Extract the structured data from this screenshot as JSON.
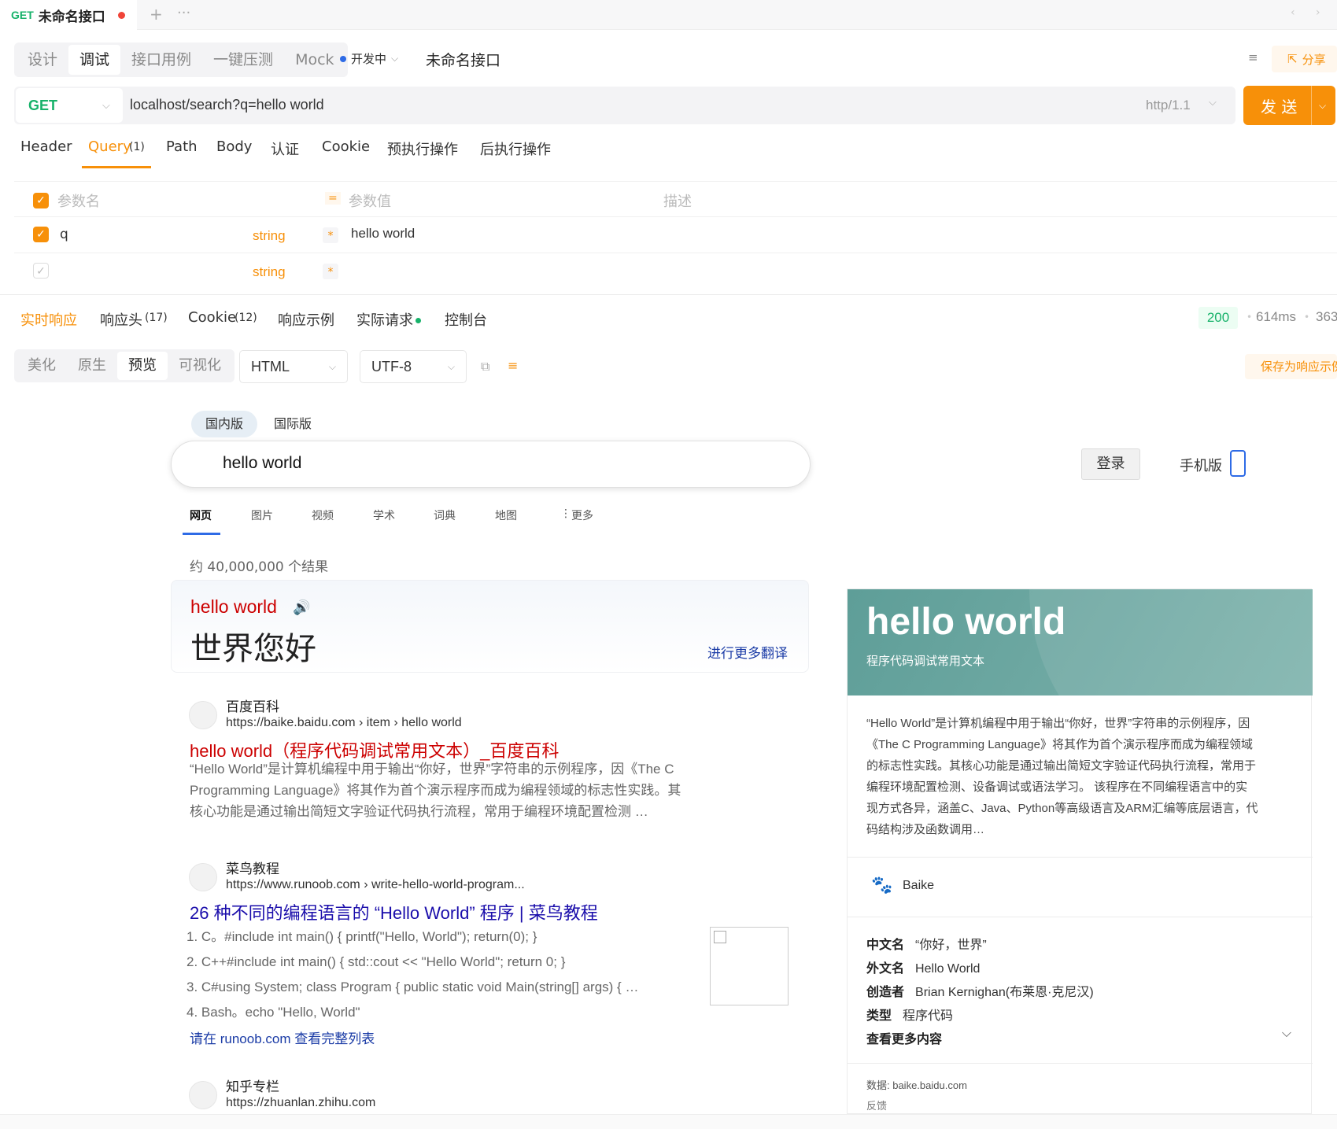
{
  "tab": {
    "method": "GET",
    "title": "未命名接口"
  },
  "modes": [
    "设计",
    "调试",
    "接口用例",
    "一键压测",
    "Mock"
  ],
  "status_label": "开发中",
  "api_name": "未命名接口",
  "share_label": "分享",
  "url": {
    "method": "GET",
    "value": "localhost/search?q=hello world",
    "protocol": "http/1.1",
    "send_label": "发 送"
  },
  "req_tabs": [
    "Header",
    "Query",
    "(1)",
    "Path",
    "Body",
    "认证",
    "Cookie",
    "预执行操作",
    "后执行操作"
  ],
  "params": {
    "headers": {
      "name": "参数名",
      "value": "参数值",
      "desc": "描述"
    },
    "rows": [
      {
        "name": "q",
        "type": "string",
        "value": "hello world"
      },
      {
        "name": "",
        "type": "string",
        "value": ""
      }
    ]
  },
  "resp_tabs": [
    "实时响应",
    "响应头",
    "(17)",
    "Cookie",
    "(12)",
    "响应示例",
    "实际请求",
    "控制台"
  ],
  "resp_meta": {
    "status": "200",
    "time": "614ms",
    "size": "363"
  },
  "view_modes": [
    "美化",
    "原生",
    "预览",
    "可视化"
  ],
  "format": "HTML",
  "encoding": "UTF-8",
  "save_example": "保存为响应示例",
  "bing": {
    "versions": [
      "国内版",
      "国际版"
    ],
    "query": "hello world",
    "login": "登录",
    "mobile": "手机版",
    "tabs": [
      "网页",
      "图片",
      "视频",
      "学术",
      "词典",
      "地图",
      "更多"
    ],
    "result_count": "约 40,000,000 个结果",
    "translate": {
      "word": "hello world",
      "meaning": "世界您好",
      "more": "进行更多翻译"
    },
    "results": [
      {
        "site": "百度百科",
        "url": "https://baike.baidu.com › item › hello world",
        "title": "hello world（程序代码调试常用文本）_百度百科",
        "snippet": [
          "“Hello World”是计算机编程中用于输出“你好，世界”字符串的示例程序，因《The C",
          "Programming Language》将其作为首个演示程序而成为编程领域的标志性实践。其",
          "核心功能是通过输出简短文字验证代码执行流程，常用于编程环境配置检测 …"
        ]
      },
      {
        "site": "菜鸟教程",
        "url": "https://www.runoob.com › write-hello-world-program...",
        "title": "26 种不同的编程语言的 “Hello World” 程序 | 菜鸟教程",
        "list": [
          "1. C。#include int main() { printf(\"Hello, World\"); return(0); }",
          "2. C++#include int main() { std::cout << \"Hello World\"; return 0; }",
          "3. C#using System; class Program { public static void Main(string[] args) { …",
          "4. Bash。echo \"Hello, World\""
        ],
        "more": "请在 runoob.com 查看完整列表"
      },
      {
        "site": "知乎专栏",
        "url": "https://zhuanlan.zhihu.com"
      }
    ],
    "card": {
      "title": "hello world",
      "subtitle": "程序代码调试常用文本",
      "desc": [
        "“Hello World”是计算机编程中用于输出“你好，世界”字符串的示例程序，因",
        "《The C Programming Language》将其作为首个演示程序而成为编程领域",
        "的标志性实践。其核心功能是通过输出简短文字验证代码执行流程，常用于",
        "编程环境配置检测、设备调试或语法学习。 该程序在不同编程语言中的实",
        "现方式各异，涵盖C、Java、Python等高级语言及ARM汇编等底层语言，代",
        "码结构涉及函数调用…"
      ],
      "source": "Baike",
      "facts": [
        {
          "k": "中文名",
          "v": "“你好，世界”"
        },
        {
          "k": "外文名",
          "v": "Hello World"
        },
        {
          "k": "创造者",
          "v": "Brian Kernighan(布莱恩·克尼汉)"
        },
        {
          "k": "类型",
          "v": "程序代码"
        }
      ],
      "more": "查看更多内容",
      "data_src": "数据: baike.baidu.com",
      "feedback": "反馈"
    }
  },
  "colors": {
    "accent": "#f79009",
    "method": "#17b26a"
  }
}
